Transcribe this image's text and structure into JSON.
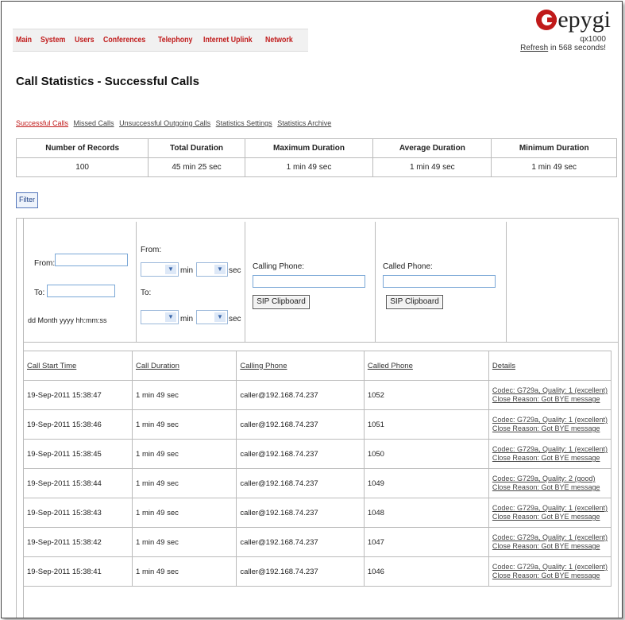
{
  "nav": {
    "items": [
      "Main",
      "System",
      "Users",
      "Conferences",
      "Telephony",
      "Internet Uplink",
      "Network"
    ]
  },
  "brand": {
    "logo_text": "epygi",
    "model": "qx1000",
    "refresh_link": "Refresh",
    "refresh_suffix": " in 568 seconds!",
    "accent_color": "#c01a1a"
  },
  "page": {
    "title": "Call Statistics - Successful Calls"
  },
  "subtabs": [
    "Successful Calls",
    "Missed Calls",
    "Unsuccessful Outgoing Calls",
    "Statistics Settings",
    "Statistics Archive"
  ],
  "summary": {
    "headers": [
      "Number of Records",
      "Total Duration",
      "Maximum Duration",
      "Average Duration",
      "Minimum Duration"
    ],
    "values": [
      "100",
      "45 min 25 sec",
      "1 min 49 sec",
      "1 min 49 sec",
      "1 min 49 sec"
    ]
  },
  "filter": {
    "button_label": "Filter",
    "from_label": "From:",
    "to_label": "To:",
    "date_format": "dd Month yyyy hh:mm:ss",
    "dur_from_label": "From:",
    "dur_to_label": "To:",
    "min_label": "min",
    "sec_label": "sec",
    "calling_label": "Calling Phone:",
    "called_label": "Called Phone:",
    "sip_clipboard": "SIP Clipboard"
  },
  "results": {
    "headers": [
      "Call Start Time",
      "Call Duration",
      "Calling Phone",
      "Called Phone",
      "Details"
    ],
    "rows": [
      {
        "start": "19-Sep-2011 15:38:47",
        "duration": "1 min 49 sec",
        "calling": "caller@192.168.74.237",
        "called": "1052",
        "detail1": "Codec: G729a, Quality: 1 (excellent)",
        "detail2": "Close Reason: Got BYE message"
      },
      {
        "start": "19-Sep-2011 15:38:46",
        "duration": "1 min 49 sec",
        "calling": "caller@192.168.74.237",
        "called": "1051",
        "detail1": "Codec: G729a, Quality: 1 (excellent)",
        "detail2": "Close Reason: Got BYE message"
      },
      {
        "start": "19-Sep-2011 15:38:45",
        "duration": "1 min 49 sec",
        "calling": "caller@192.168.74.237",
        "called": "1050",
        "detail1": "Codec: G729a, Quality: 1 (excellent)",
        "detail2": "Close Reason: Got BYE message"
      },
      {
        "start": "19-Sep-2011 15:38:44",
        "duration": "1 min 49 sec",
        "calling": "caller@192.168.74.237",
        "called": "1049",
        "detail1": "Codec: G729a, Quality: 2 (good)",
        "detail2": "Close Reason: Got BYE message"
      },
      {
        "start": "19-Sep-2011 15:38:43",
        "duration": "1 min 49 sec",
        "calling": "caller@192.168.74.237",
        "called": "1048",
        "detail1": "Codec: G729a, Quality: 1 (excellent)",
        "detail2": "Close Reason: Got BYE message"
      },
      {
        "start": "19-Sep-2011 15:38:42",
        "duration": "1 min 49 sec",
        "calling": "caller@192.168.74.237",
        "called": "1047",
        "detail1": "Codec: G729a, Quality: 1 (excellent)",
        "detail2": "Close Reason: Got BYE message"
      },
      {
        "start": "19-Sep-2011 15:38:41",
        "duration": "1 min 49 sec",
        "calling": "caller@192.168.74.237",
        "called": "1046",
        "detail1": "Codec: G729a, Quality: 1 (excellent)",
        "detail2": "Close Reason: Got BYE message"
      }
    ]
  }
}
